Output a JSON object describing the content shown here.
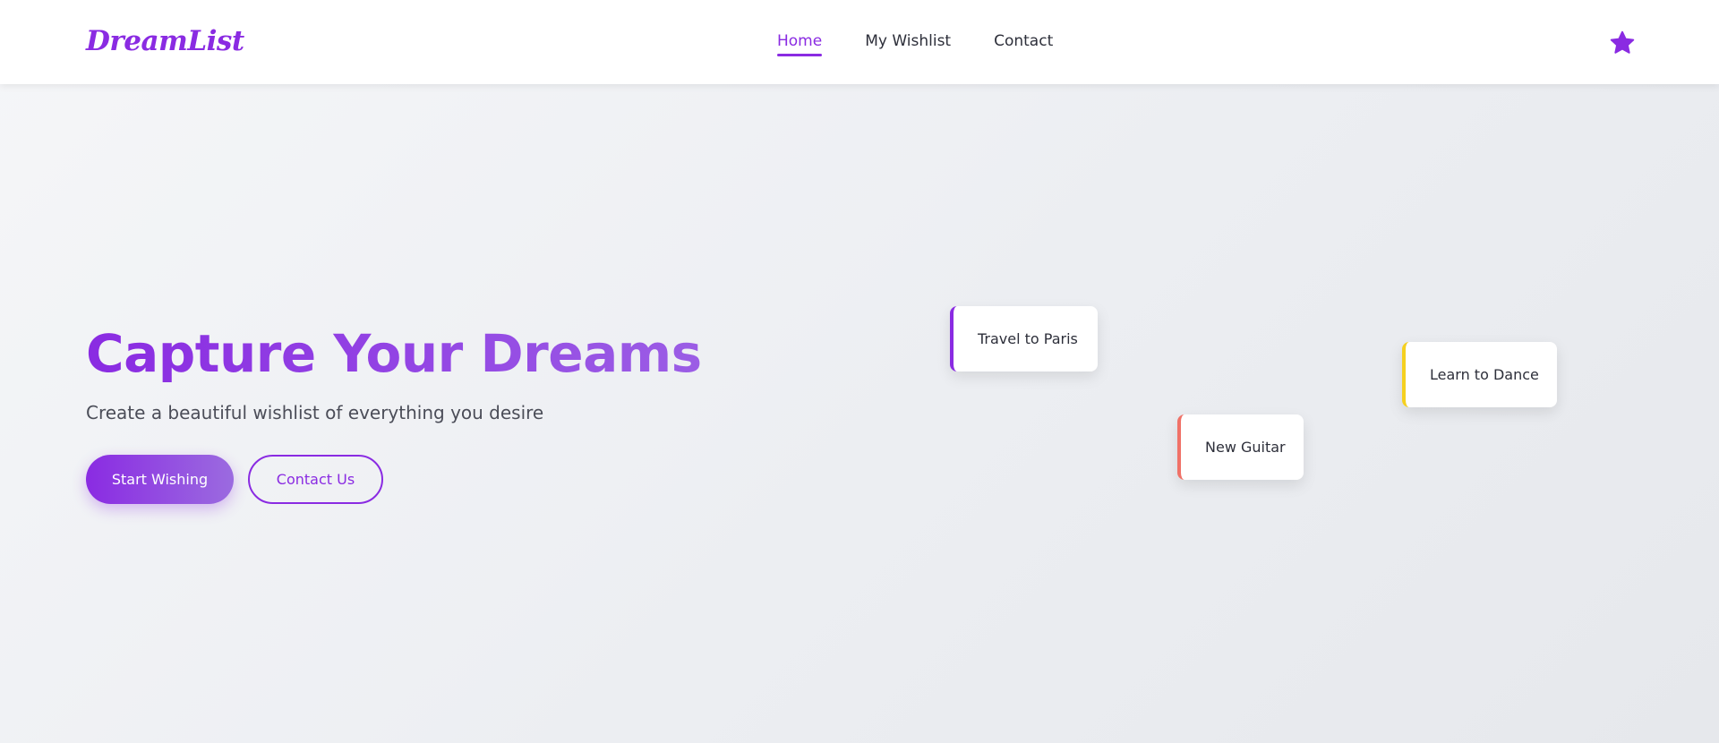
{
  "header": {
    "logo": "DreamList",
    "nav": [
      {
        "label": "Home",
        "active": true
      },
      {
        "label": "My Wishlist",
        "active": false
      },
      {
        "label": "Contact",
        "active": false
      }
    ],
    "action_icon": "star-icon"
  },
  "hero": {
    "title": "Capture Your Dreams",
    "subtitle": "Create a beautiful wishlist of everything you desire",
    "primary_button": "Start Wishing",
    "secondary_button": "Contact Us"
  },
  "wish_cards": [
    {
      "label": "Travel to Paris",
      "accent": "#8a2be2"
    },
    {
      "label": "Learn to Dance",
      "accent": "#f5d01f"
    },
    {
      "label": "New Guitar",
      "accent": "#f07167"
    }
  ],
  "theme": {
    "accent": "#8a2be2",
    "accent_light": "#9b6be0",
    "text": "#2d2f3a"
  }
}
